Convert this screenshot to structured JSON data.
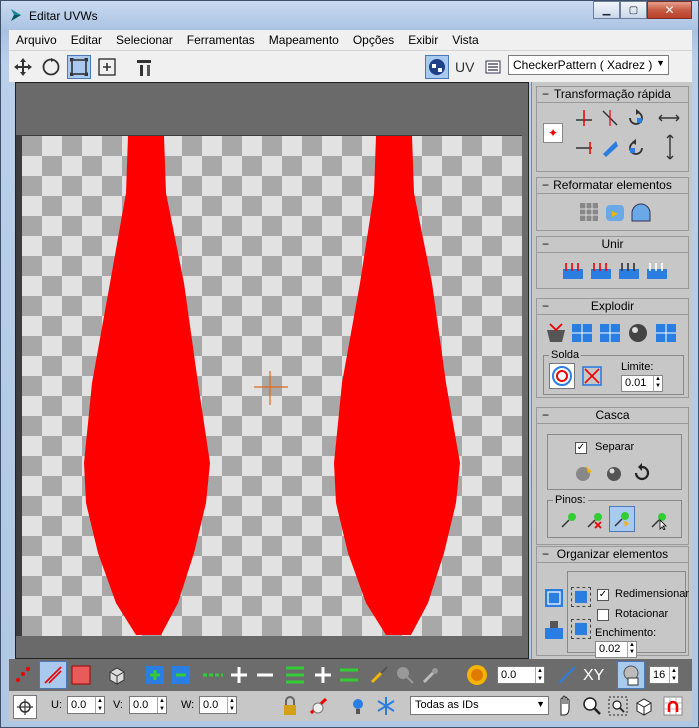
{
  "window": {
    "title": "Editar UVWs",
    "buttons": {
      "minimize": "▁",
      "maximize": "▢",
      "close": "✕"
    }
  },
  "menu": [
    "Arquivo",
    "Editar",
    "Selecionar",
    "Ferramentas",
    "Mapeamento",
    "Opções",
    "Exibir",
    "Vista"
  ],
  "toolbar": {
    "tools": [
      "move-icon",
      "rotate-icon",
      "scale-icon",
      "freeform-icon",
      "mirror-icon"
    ],
    "uv_label": "UV",
    "texture_dropdown": "CheckerPattern  ( Xadrez )"
  },
  "panel": {
    "quick_transform": {
      "title": "Transformação rápida"
    },
    "reshape": {
      "title": "Reformatar elementos"
    },
    "stitch": {
      "title": "Unir"
    },
    "explode": {
      "title": "Explodir",
      "weld_group": "Solda",
      "threshold_label": "Limite:",
      "threshold_value": "0.01"
    },
    "peel": {
      "title": "Casca",
      "detach_label": "Separar",
      "detach_checked": true,
      "pins_group": "Pinos:"
    },
    "arrange": {
      "title": "Organizar elementos",
      "rescale_label": "Redimensionar",
      "rescale_checked": true,
      "rotate_label": "Rotacionar",
      "rotate_checked": false,
      "padding_label": "Enchimento:",
      "padding_value": "0.02"
    }
  },
  "bottom_bar": {
    "soft_value": "0.0",
    "xy_label": "XY",
    "grid_value": "16",
    "u_label": "U:",
    "u_value": "0.0",
    "v_label": "V:",
    "v_value": "0.0",
    "w_label": "W:",
    "w_value": "0.0",
    "ids_dropdown": "Todas as IDs"
  },
  "colors": {
    "uv_shells": "#ff0000",
    "active_button": "#aac9ef",
    "panel_bg": "#c7c7c7"
  }
}
